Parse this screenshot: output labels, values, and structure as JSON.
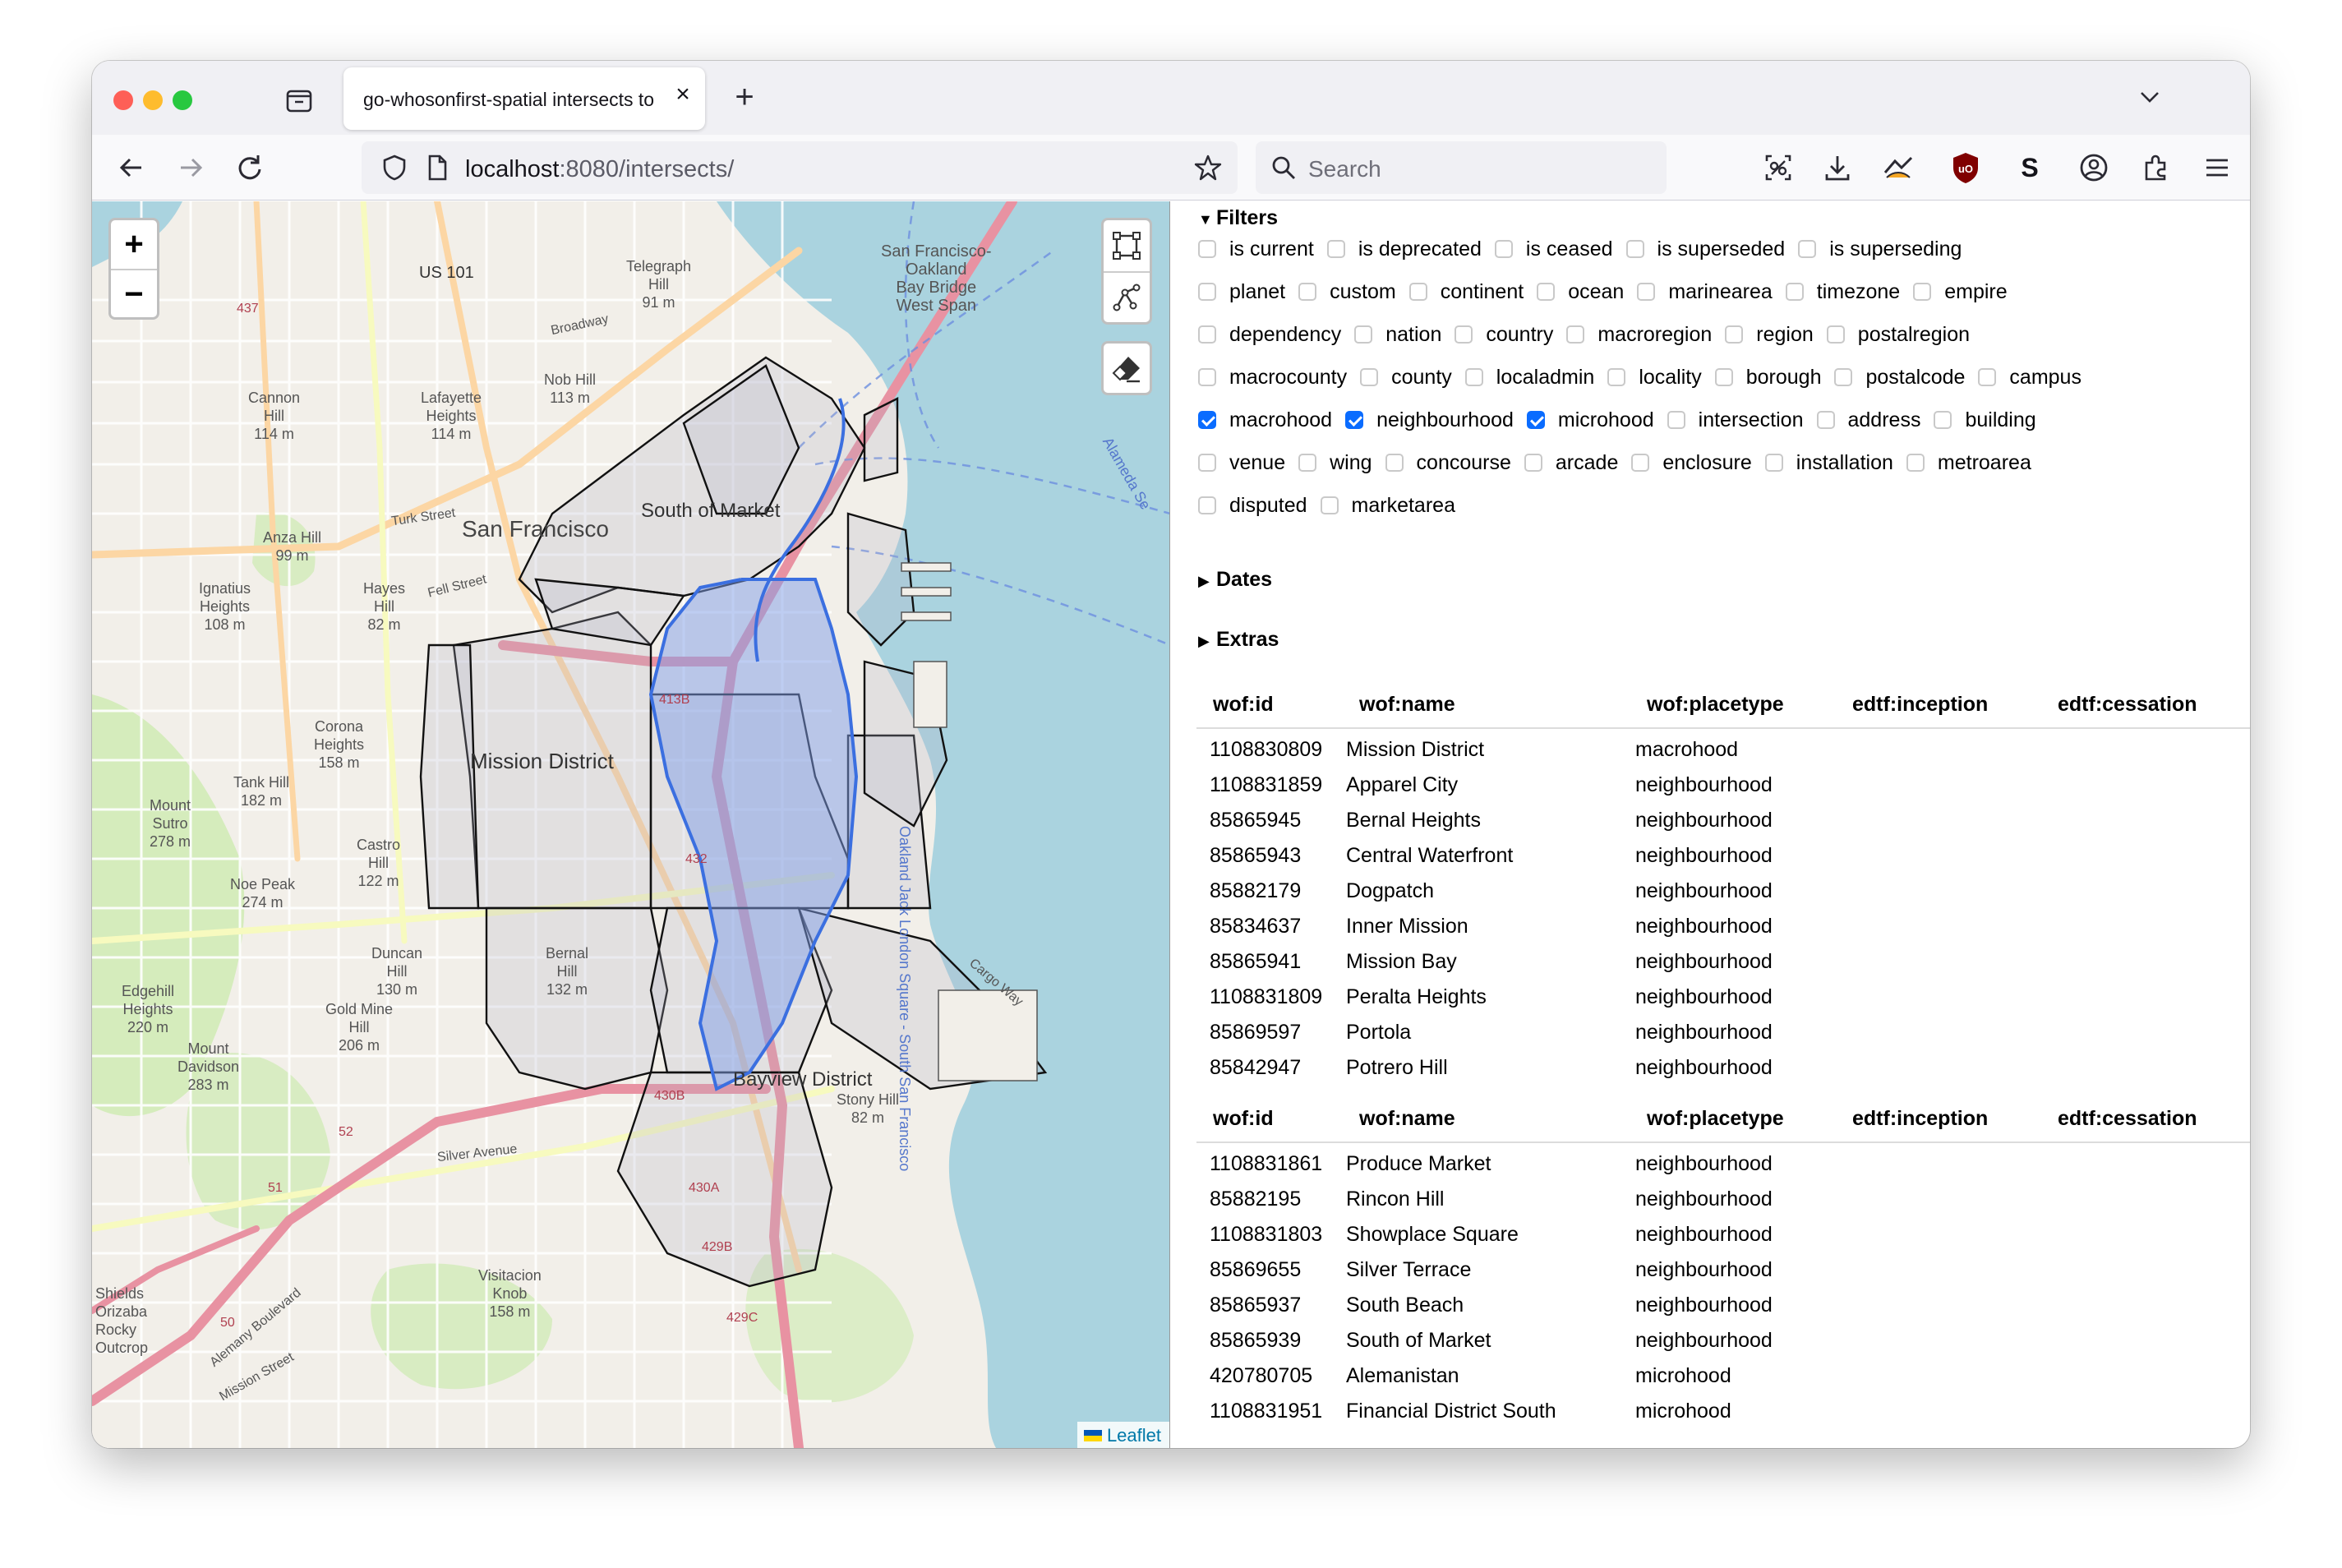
{
  "browser": {
    "tab_title": "go-whosonfirst-spatial intersects to",
    "url_host": "localhost",
    "url_path": ":8080/intersects/",
    "search_placeholder": "Search"
  },
  "map": {
    "zoom_in": "+",
    "zoom_out": "−",
    "attribution": "Leaflet",
    "labels": {
      "san_francisco": "San Francisco",
      "south_of_market": "South of Market",
      "mission_district": "Mission District",
      "bayview_district": "Bayview District",
      "bay_bridge": "San Francisco-\nOakland\nBay Bridge\nWest Span",
      "telegraph_hill": "Telegraph\nHill\n91 m",
      "nob_hill": "Nob Hill\n113 m",
      "lafayette_heights": "Lafayette\nHeights\n114 m",
      "cannon_hill": "Cannon\nHill\n114 m",
      "anza_hill": "Anza Hill\n99 m",
      "ignatius_heights": "Ignatius\nHeights\n108 m",
      "hayes_hill": "Hayes\nHill\n82 m",
      "corona_heights": "Corona\nHeights\n158 m",
      "tank_hill": "Tank Hill\n182 m",
      "mount_sutro": "Mount\nSutro\n278 m",
      "castro_hill": "Castro\nHill\n122 m",
      "noe_peak": "Noe Peak\n274 m",
      "duncan_hill": "Duncan\nHill\n130 m",
      "bernal_hill": "Bernal\nHill\n132 m",
      "gold_mine_hill": "Gold Mine\nHill\n206 m",
      "edgehill_heights": "Edgehill\nHeights\n220 m",
      "mount_davidson": "Mount\nDavidson\n283 m",
      "stony_hill": "Stony Hill\n82 m",
      "visitacion_knob": "Visitacion\nKnob\n158 m",
      "shields_orizaba": "Shields\nOrizaba\nRocky\nOutcrop",
      "us101": "US 101",
      "broadway": "Broadway",
      "turk_street": "Turk Street",
      "fell_street": "Fell Street",
      "silver_avenue": "Silver Avenue",
      "mission_street": "Mission Street",
      "alemany_boulevard": "Alemany Boulevard",
      "oakland_jack_london": "Oakland Jack London Square - South San Francisco",
      "alameda": "Alameda Se",
      "cargo_way": "Cargo Way",
      "r437": "437",
      "r413b": "413B",
      "r432": "432",
      "r430b": "430B",
      "r429b": "429B",
      "r429c": "429C",
      "r430a": "430A",
      "r52": "52",
      "r51": "51",
      "r50": "50"
    },
    "colors": {
      "water": "#aad3df",
      "land": "#f2efe9",
      "park": "#cdebb0",
      "highlight_fill": "#7f9ee8",
      "highlight_stroke": "#3b6fe0",
      "motorway": "#e892a2",
      "primary": "#fcd6a4",
      "secondary": "#f7fabf"
    }
  },
  "filters": {
    "summary": "Filters",
    "rows": [
      [
        {
          "label": "is current",
          "checked": false
        },
        {
          "label": "is deprecated",
          "checked": false
        },
        {
          "label": "is ceased",
          "checked": false
        },
        {
          "label": "is superseded",
          "checked": false
        },
        {
          "label": "is superseding",
          "checked": false
        }
      ],
      [
        {
          "label": "planet",
          "checked": false
        },
        {
          "label": "custom",
          "checked": false
        },
        {
          "label": "continent",
          "checked": false
        },
        {
          "label": "ocean",
          "checked": false
        },
        {
          "label": "marinearea",
          "checked": false
        },
        {
          "label": "timezone",
          "checked": false
        },
        {
          "label": "empire",
          "checked": false
        }
      ],
      [
        {
          "label": "dependency",
          "checked": false
        },
        {
          "label": "nation",
          "checked": false
        },
        {
          "label": "country",
          "checked": false
        },
        {
          "label": "macroregion",
          "checked": false
        },
        {
          "label": "region",
          "checked": false
        },
        {
          "label": "postalregion",
          "checked": false
        }
      ],
      [
        {
          "label": "macrocounty",
          "checked": false
        },
        {
          "label": "county",
          "checked": false
        },
        {
          "label": "localadmin",
          "checked": false
        },
        {
          "label": "locality",
          "checked": false
        },
        {
          "label": "borough",
          "checked": false
        },
        {
          "label": "postalcode",
          "checked": false
        },
        {
          "label": "campus",
          "checked": false
        }
      ],
      [
        {
          "label": "macrohood",
          "checked": true
        },
        {
          "label": "neighbourhood",
          "checked": true
        },
        {
          "label": "microhood",
          "checked": true
        },
        {
          "label": "intersection",
          "checked": false
        },
        {
          "label": "address",
          "checked": false
        },
        {
          "label": "building",
          "checked": false
        }
      ],
      [
        {
          "label": "venue",
          "checked": false
        },
        {
          "label": "wing",
          "checked": false
        },
        {
          "label": "concourse",
          "checked": false
        },
        {
          "label": "arcade",
          "checked": false
        },
        {
          "label": "enclosure",
          "checked": false
        },
        {
          "label": "installation",
          "checked": false
        },
        {
          "label": "metroarea",
          "checked": false
        }
      ],
      [
        {
          "label": "disputed",
          "checked": false
        },
        {
          "label": "marketarea",
          "checked": false
        }
      ]
    ]
  },
  "dates": {
    "summary": "Dates"
  },
  "extras": {
    "summary": "Extras"
  },
  "table": {
    "columns": [
      "wof:id",
      "wof:name",
      "wof:placetype",
      "edtf:inception",
      "edtf:cessation"
    ],
    "page1": [
      [
        "1108830809",
        "Mission District",
        "macrohood",
        "",
        ""
      ],
      [
        "1108831859",
        "Apparel City",
        "neighbourhood",
        "",
        ""
      ],
      [
        "85865945",
        "Bernal Heights",
        "neighbourhood",
        "",
        ""
      ],
      [
        "85865943",
        "Central Waterfront",
        "neighbourhood",
        "",
        ""
      ],
      [
        "85882179",
        "Dogpatch",
        "neighbourhood",
        "",
        ""
      ],
      [
        "85834637",
        "Inner Mission",
        "neighbourhood",
        "",
        ""
      ],
      [
        "85865941",
        "Mission Bay",
        "neighbourhood",
        "",
        ""
      ],
      [
        "1108831809",
        "Peralta Heights",
        "neighbourhood",
        "",
        ""
      ],
      [
        "85869597",
        "Portola",
        "neighbourhood",
        "",
        ""
      ],
      [
        "85842947",
        "Potrero Hill",
        "neighbourhood",
        "",
        ""
      ]
    ],
    "page2": [
      [
        "1108831861",
        "Produce Market",
        "neighbourhood",
        "",
        ""
      ],
      [
        "85882195",
        "Rincon Hill",
        "neighbourhood",
        "",
        ""
      ],
      [
        "1108831803",
        "Showplace Square",
        "neighbourhood",
        "",
        ""
      ],
      [
        "85869655",
        "Silver Terrace",
        "neighbourhood",
        "",
        ""
      ],
      [
        "85865937",
        "South Beach",
        "neighbourhood",
        "",
        ""
      ],
      [
        "85865939",
        "South of Market",
        "neighbourhood",
        "",
        ""
      ],
      [
        "420780705",
        "Alemanistan",
        "microhood",
        "",
        ""
      ],
      [
        "1108831951",
        "Financial District South",
        "microhood",
        "",
        ""
      ]
    ]
  }
}
